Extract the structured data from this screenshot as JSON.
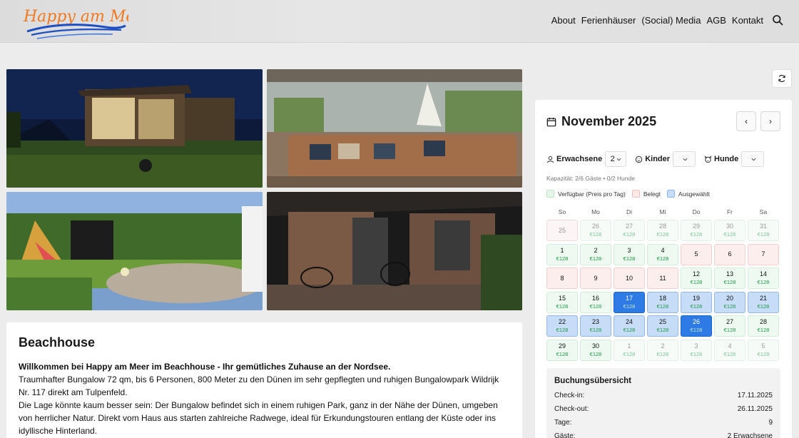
{
  "header": {
    "logo_text": "Happy am Meer",
    "nav": [
      "About",
      "Ferienhäuser",
      "(Social) Media",
      "AGB",
      "Kontakt"
    ]
  },
  "description": {
    "title": "Beachhouse",
    "intro": "Willkommen bei Happy am Meer im Beachhouse  - Ihr gemütliches Zuhause an der Nordsee.",
    "paragraph1": "Traumhafter Bungalow  72 qm,  bis 6 Personen,  800 Meter zu den Dünen im  sehr gepflegten und ruhigen Bungalowpark Wildrijk  Nr. 117  direkt am Tulpenfeld.",
    "paragraph2": "Die Lage könnte kaum besser sein: Der Bungalow befindet sich in einem ruhigen Park, ganz in der Nähe der Dünen, umgeben von herrlicher Natur. Direkt vom Haus aus starten zahlreiche Radwege, ideal für Erkundungstouren entlang der Küste oder ins idyllische Hinterland."
  },
  "calendar": {
    "month_title": "November 2025",
    "prev_label": "‹",
    "next_label": "›",
    "adults_label": "Erwachsene",
    "adults_value": "2",
    "children_label": "Kinder",
    "children_value": "",
    "dogs_label": "Hunde",
    "dogs_value": "",
    "capacity": "Kapazität: 2/6 Gäste • 0/2 Hunde",
    "legend": [
      {
        "label": "Verfügbar (Preis pro Tag)",
        "color": "#e6f7ea",
        "border": "#bfe3c9"
      },
      {
        "label": "Belegt",
        "color": "#fde8e8",
        "border": "#efc2c2"
      },
      {
        "label": "Ausgewählt",
        "color": "#c6dcf7",
        "border": "#8fb6ea"
      }
    ],
    "weekdays": [
      "So",
      "Mo",
      "Di",
      "Mi",
      "Do",
      "Fr",
      "Sa"
    ],
    "days": [
      {
        "d": "25",
        "s": "past",
        "p": ""
      },
      {
        "d": "26",
        "s": "outside",
        "p": "€128"
      },
      {
        "d": "27",
        "s": "outside",
        "p": "€128"
      },
      {
        "d": "28",
        "s": "outside",
        "p": "€128"
      },
      {
        "d": "29",
        "s": "outside",
        "p": "€128"
      },
      {
        "d": "30",
        "s": "outside",
        "p": "€128"
      },
      {
        "d": "31",
        "s": "outside",
        "p": "€128"
      },
      {
        "d": "1",
        "s": "available",
        "p": "€128"
      },
      {
        "d": "2",
        "s": "available",
        "p": "€128"
      },
      {
        "d": "3",
        "s": "available",
        "p": "€128"
      },
      {
        "d": "4",
        "s": "available",
        "p": "€128"
      },
      {
        "d": "5",
        "s": "booked",
        "p": ""
      },
      {
        "d": "6",
        "s": "booked",
        "p": ""
      },
      {
        "d": "7",
        "s": "booked",
        "p": ""
      },
      {
        "d": "8",
        "s": "booked",
        "p": ""
      },
      {
        "d": "9",
        "s": "booked",
        "p": ""
      },
      {
        "d": "10",
        "s": "booked",
        "p": ""
      },
      {
        "d": "11",
        "s": "booked",
        "p": ""
      },
      {
        "d": "12",
        "s": "available",
        "p": "€128"
      },
      {
        "d": "13",
        "s": "available",
        "p": "€128"
      },
      {
        "d": "14",
        "s": "available",
        "p": "€128"
      },
      {
        "d": "15",
        "s": "available",
        "p": "€128"
      },
      {
        "d": "16",
        "s": "available",
        "p": "€128"
      },
      {
        "d": "17",
        "s": "endpoint",
        "p": "€128"
      },
      {
        "d": "18",
        "s": "selected",
        "p": "€128"
      },
      {
        "d": "19",
        "s": "selected",
        "p": "€128"
      },
      {
        "d": "20",
        "s": "selected",
        "p": "€128"
      },
      {
        "d": "21",
        "s": "selected",
        "p": "€128"
      },
      {
        "d": "22",
        "s": "selected",
        "p": "€128"
      },
      {
        "d": "23",
        "s": "selected",
        "p": "€128"
      },
      {
        "d": "24",
        "s": "selected",
        "p": "€128"
      },
      {
        "d": "25",
        "s": "selected",
        "p": "€128"
      },
      {
        "d": "26",
        "s": "endpoint",
        "p": "€128"
      },
      {
        "d": "27",
        "s": "available",
        "p": "€128"
      },
      {
        "d": "28",
        "s": "available",
        "p": "€128"
      },
      {
        "d": "29",
        "s": "available",
        "p": "€128"
      },
      {
        "d": "30",
        "s": "available",
        "p": "€128"
      },
      {
        "d": "1",
        "s": "outside",
        "p": "€128"
      },
      {
        "d": "2",
        "s": "outside",
        "p": "€128"
      },
      {
        "d": "3",
        "s": "outside",
        "p": "€128"
      },
      {
        "d": "4",
        "s": "outside",
        "p": "€128"
      },
      {
        "d": "5",
        "s": "outside",
        "p": "€128"
      }
    ]
  },
  "summary": {
    "title": "Buchungsübersicht",
    "rows": [
      {
        "label": "Check-in:",
        "value": "17.11.2025"
      },
      {
        "label": "Check-out:",
        "value": "26.11.2025"
      },
      {
        "label": "Tage:",
        "value": "9"
      },
      {
        "label": "Gäste:",
        "value": "2 Erwachsene"
      }
    ]
  }
}
